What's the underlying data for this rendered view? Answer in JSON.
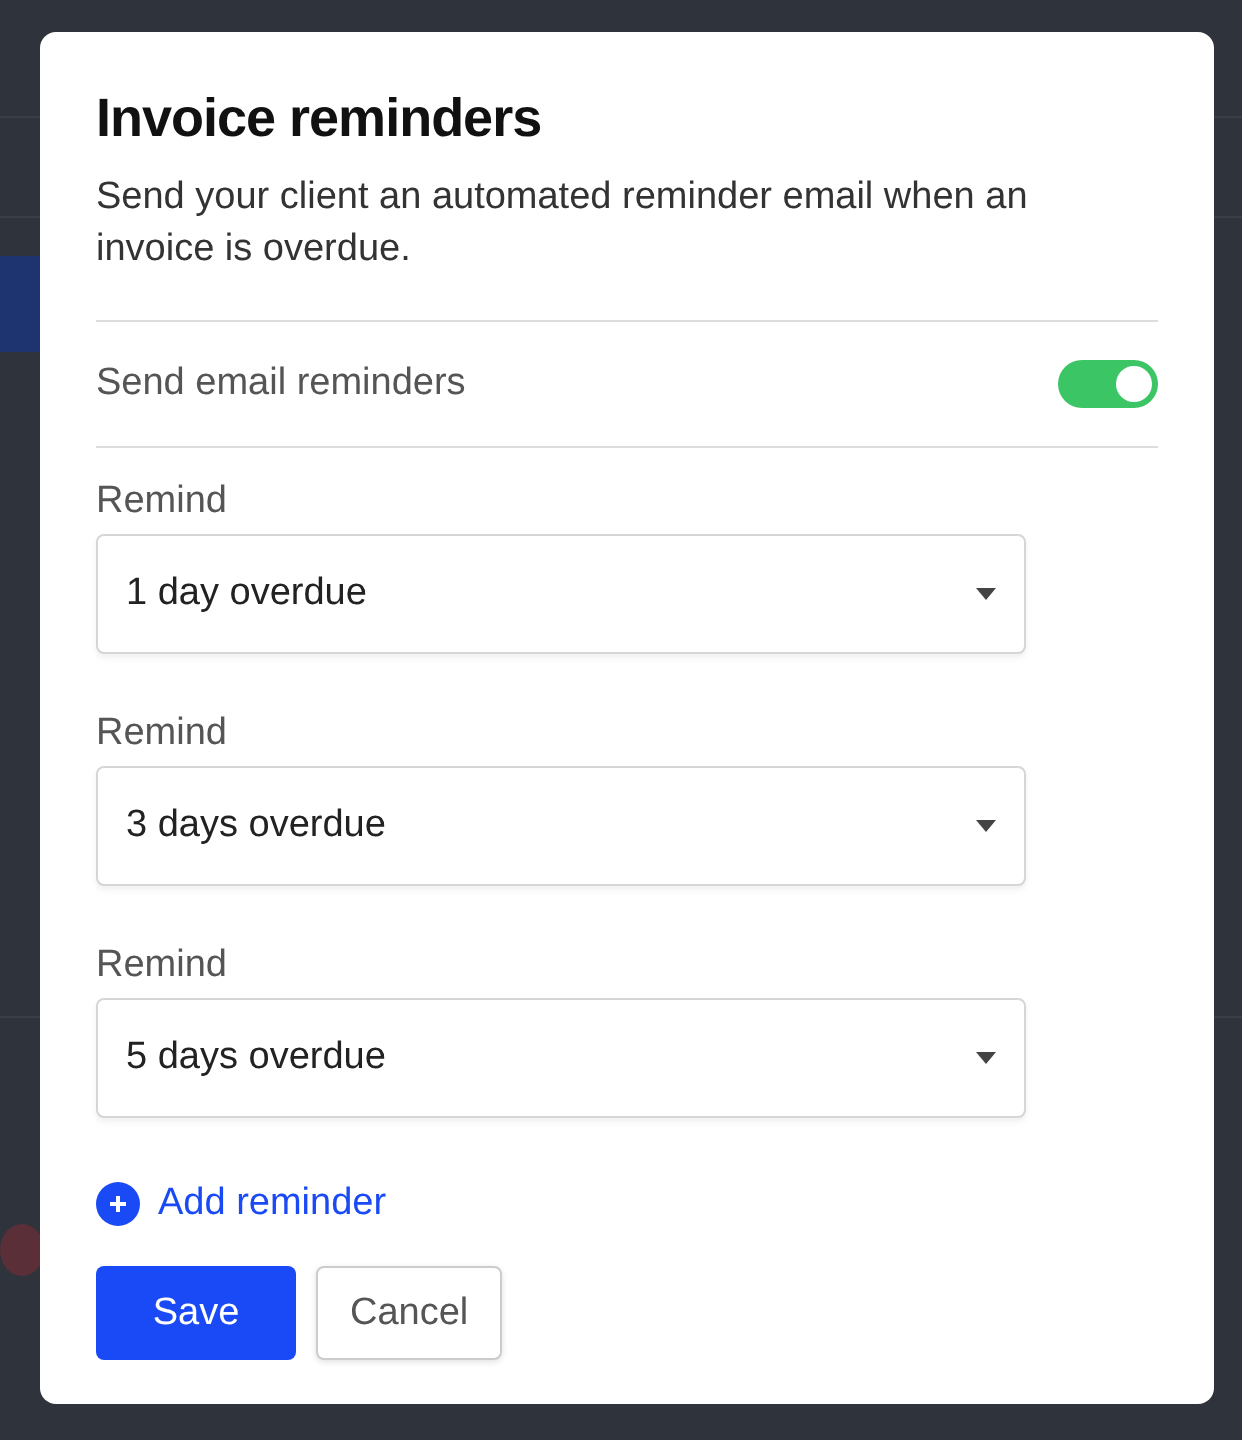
{
  "dialog": {
    "title": "Invoice reminders",
    "description": "Send your client an automated reminder email when an invoice is overdue.",
    "setting": {
      "label": "Send email reminders",
      "on": true
    },
    "reminders": [
      {
        "label": "Remind",
        "value": "1 day overdue"
      },
      {
        "label": "Remind",
        "value": "3 days overdue"
      },
      {
        "label": "Remind",
        "value": "5 days overdue"
      }
    ],
    "add_link": "Add reminder",
    "buttons": [
      {
        "label": "Save",
        "kind": "primary"
      },
      {
        "label": "Cancel",
        "kind": "secondary"
      }
    ]
  }
}
